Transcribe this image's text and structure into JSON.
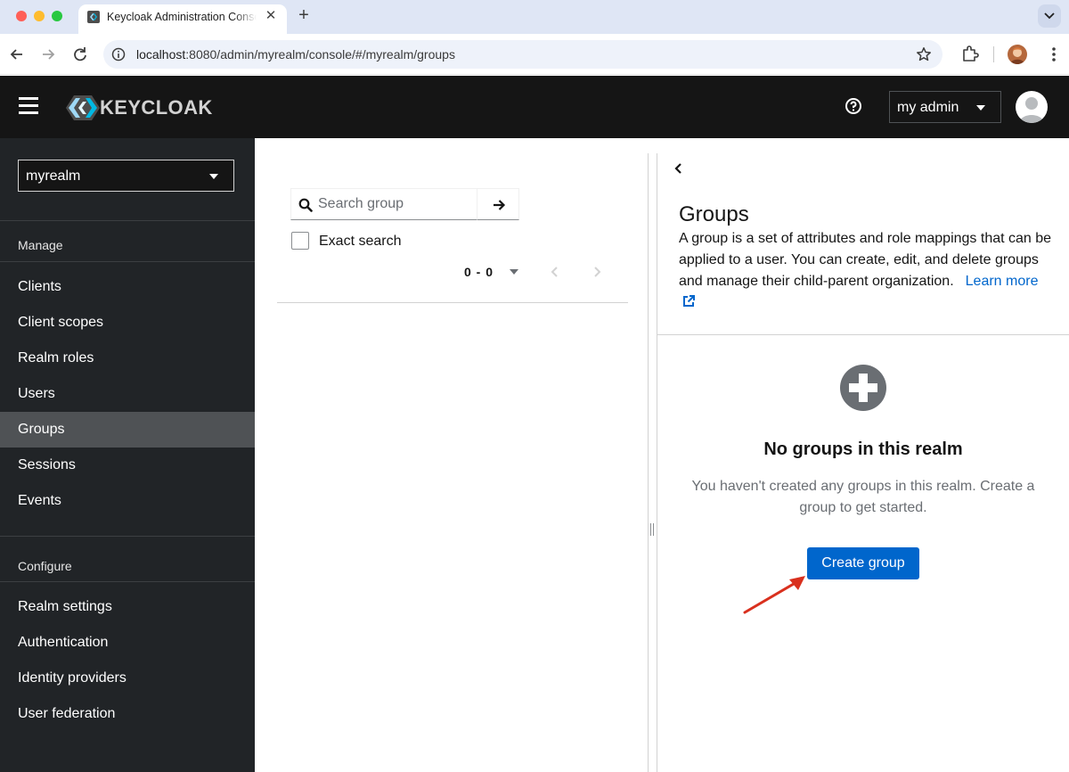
{
  "browser": {
    "tab_title": "Keycloak Administration Console",
    "url_host": "localhost",
    "url_rest": ":8080/admin/myrealm/console/#/myrealm/groups",
    "icons": [
      "keycloak-favicon-icon",
      "close-icon",
      "plus-icon",
      "chevron-down-icon",
      "back-icon",
      "forward-icon",
      "reload-icon",
      "info-icon",
      "star-icon",
      "extension-icon",
      "profile-icon",
      "kebab-icon"
    ]
  },
  "header": {
    "brand": "KEYCLOAK",
    "user_menu": "my admin",
    "icons": [
      "hamburger-icon",
      "help-icon",
      "avatar-icon",
      "caret-down-icon"
    ]
  },
  "sidebar": {
    "realm": "myrealm",
    "manage_label": "Manage",
    "manage_items": [
      "Clients",
      "Client scopes",
      "Realm roles",
      "Users",
      "Groups",
      "Sessions",
      "Events"
    ],
    "active_item": "Groups",
    "configure_label": "Configure",
    "configure_items": [
      "Realm settings",
      "Authentication",
      "Identity providers",
      "User federation"
    ]
  },
  "tree_panel": {
    "search_placeholder": "Search group",
    "exact_search_label": "Exact search",
    "pagination": "0 - 0"
  },
  "main": {
    "title": "Groups",
    "description": "A group is a set of attributes and role mappings that can be applied to a user. You can create, edit, and delete groups and manage their child-parent organization.",
    "learn_more": "Learn more",
    "empty_title": "No groups in this realm",
    "empty_body": "You haven't created any groups in this realm. Create a group to get started.",
    "create_button": "Create group"
  },
  "colors": {
    "header_bg": "#151515",
    "sidebar_bg": "#212427",
    "sidebar_active": "#4f5255",
    "primary": "#0066cc",
    "annotation_arrow": "#d9301e"
  }
}
